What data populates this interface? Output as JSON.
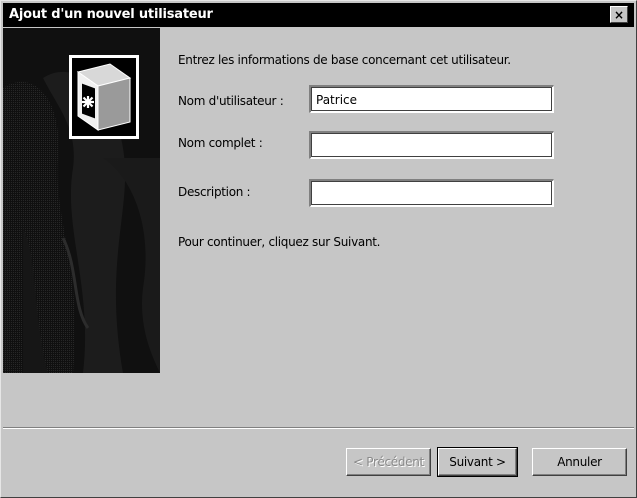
{
  "window": {
    "title": "Ajout d'un nouvel utilisateur",
    "close_label": "×"
  },
  "content": {
    "intro": "Entrez les informations de base concernant cet utilisateur.",
    "fields": {
      "username": {
        "label": "Nom d'utilisateur :",
        "value": "Patrice"
      },
      "fullname": {
        "label": "Nom complet :",
        "value": ""
      },
      "description": {
        "label": "Description :",
        "value": ""
      }
    },
    "continue_hint": "Pour continuer, cliquez sur Suivant."
  },
  "buttons": {
    "previous": "< Précédent",
    "next": "Suivant >",
    "cancel": "Annuler"
  },
  "icons": {
    "wizard_logo": "user-account-icon"
  }
}
